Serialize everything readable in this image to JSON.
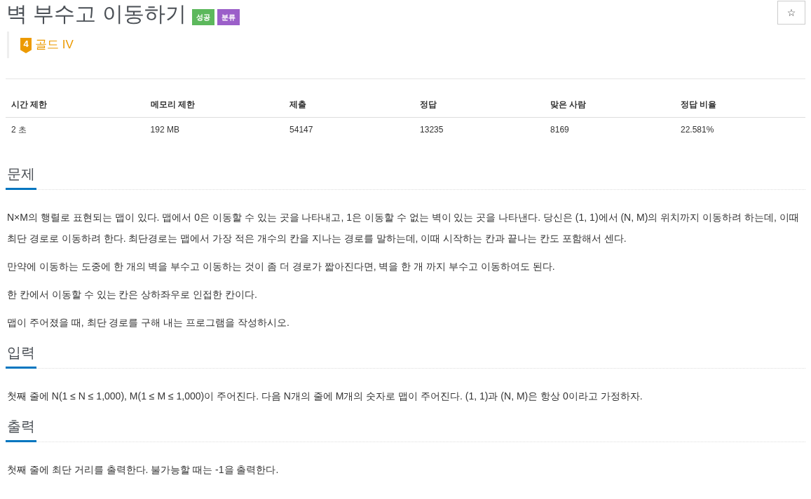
{
  "problem": {
    "title": "벽 부수고 이동하기",
    "badges": [
      {
        "label": "성공",
        "color": "#5cb85c"
      },
      {
        "label": "분류",
        "color": "#9b5fc9"
      }
    ],
    "star_button": "☆",
    "tier": {
      "level": "4",
      "label": "골드 IV"
    }
  },
  "stats_table": {
    "columns": [
      "시간 제한",
      "메모리 제한",
      "제출",
      "정답",
      "맞은 사람",
      "정답 비율"
    ],
    "rows": [
      [
        "2 초",
        "192 MB",
        "54147",
        "13235",
        "8169",
        "22.581%"
      ]
    ]
  },
  "sections": [
    {
      "heading": "문제",
      "paragraphs": [
        "N×M의 행렬로 표현되는 맵이 있다. 맵에서 0은 이동할 수 있는 곳을 나타내고, 1은 이동할 수 없는 벽이 있는 곳을 나타낸다. 당신은 (1, 1)에서 (N, M)의 위치까지 이동하려 하는데, 이때 최단 경로로 이동하려 한다. 최단경로는 맵에서 가장 적은 개수의 칸을 지나는 경로를 말하는데, 이때 시작하는 칸과 끝나는 칸도 포함해서 센다.",
        "만약에 이동하는 도중에 한 개의 벽을 부수고 이동하는 것이 좀 더 경로가 짧아진다면, 벽을 한 개 까지 부수고 이동하여도 된다.",
        "한 칸에서 이동할 수 있는 칸은 상하좌우로 인접한 칸이다.",
        "맵이 주어졌을 때, 최단 경로를 구해 내는 프로그램을 작성하시오."
      ]
    },
    {
      "heading": "입력",
      "paragraphs": [
        "첫째 줄에 N(1 ≤ N ≤ 1,000), M(1 ≤ M ≤ 1,000)이 주어진다. 다음 N개의 줄에 M개의 숫자로 맵이 주어진다. (1, 1)과 (N, M)은 항상 0이라고 가정하자."
      ]
    },
    {
      "heading": "출력",
      "paragraphs": [
        "첫째 줄에 최단 거리를 출력한다. 불가능할 때는 -1을 출력한다."
      ]
    }
  ]
}
